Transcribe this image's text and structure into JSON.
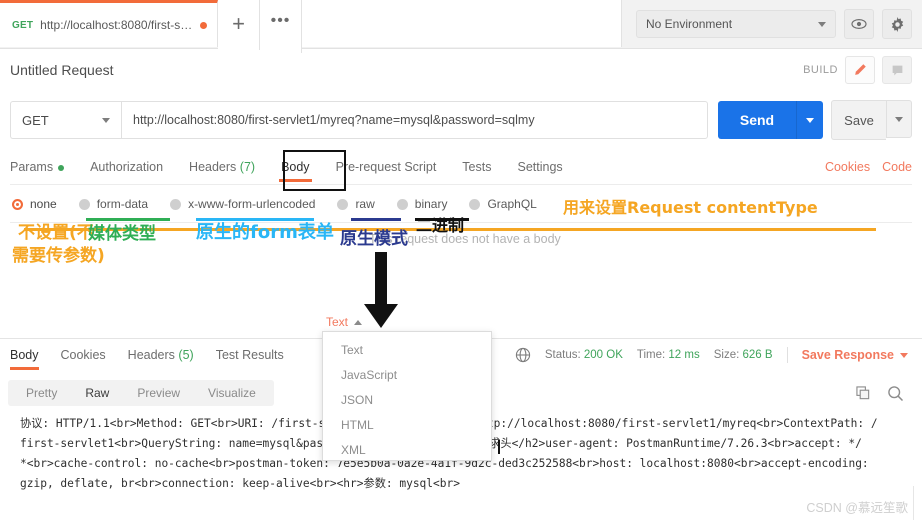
{
  "tabstrip": {
    "request_tab": {
      "method": "GET",
      "url": "http://localhost:8080/first-servl...",
      "unsaved": true
    },
    "new_tab_label": "+",
    "more_label": "•••",
    "environment": {
      "selected": "No Environment"
    },
    "eye_icon": "eye-icon",
    "gear_icon": "gear-icon"
  },
  "request_header": {
    "title": "Untitled Request",
    "build_label": "BUILD",
    "edit_icon": "pencil-icon",
    "comment_icon": "comment-icon"
  },
  "urlbar": {
    "method": "GET",
    "url": "http://localhost:8080/first-servlet1/myreq?name=mysql&password=sqlmy",
    "send_label": "Send",
    "save_label": "Save"
  },
  "request_tabs": {
    "items": [
      {
        "label": "Params",
        "badge": "",
        "dot": true,
        "active": false
      },
      {
        "label": "Authorization",
        "badge": "",
        "dot": false,
        "active": false
      },
      {
        "label": "Headers",
        "badge": "(7)",
        "dot": false,
        "active": false
      },
      {
        "label": "Body",
        "badge": "",
        "dot": false,
        "active": true
      },
      {
        "label": "Pre-request Script",
        "badge": "",
        "dot": false,
        "active": false
      },
      {
        "label": "Tests",
        "badge": "",
        "dot": false,
        "active": false
      },
      {
        "label": "Settings",
        "badge": "",
        "dot": false,
        "active": false
      }
    ],
    "right_links": [
      "Cookies",
      "Code"
    ]
  },
  "body_types": {
    "options": [
      {
        "label": "none",
        "selected": true
      },
      {
        "label": "form-data",
        "selected": false
      },
      {
        "label": "x-www-form-urlencoded",
        "selected": false
      },
      {
        "label": "raw",
        "selected": false
      },
      {
        "label": "binary",
        "selected": false
      },
      {
        "label": "GraphQL",
        "selected": false
      }
    ],
    "empty_message": "This request does not have a body"
  },
  "text_type": {
    "selected": "Text",
    "options": [
      "Text",
      "JavaScript",
      "JSON",
      "HTML",
      "XML"
    ]
  },
  "response": {
    "tabs": [
      {
        "label": "Body",
        "badge": "",
        "active": true
      },
      {
        "label": "Cookies",
        "badge": "",
        "active": false
      },
      {
        "label": "Headers",
        "badge": "(5)",
        "active": false
      },
      {
        "label": "Test Results",
        "badge": "",
        "active": false
      }
    ],
    "globe_icon": "globe-icon",
    "status_label": "Status:",
    "status_value": "200 OK",
    "time_label": "Time:",
    "time_value": "12 ms",
    "size_label": "Size:",
    "size_value": "626 B",
    "save_response_label": "Save Response",
    "view_tabs": [
      {
        "label": "Pretty",
        "active": false
      },
      {
        "label": "Raw",
        "active": true
      },
      {
        "label": "Preview",
        "active": false
      },
      {
        "label": "Visualize",
        "active": false
      }
    ],
    "copy_icon": "copy-icon",
    "search_icon": "search-icon",
    "body_lines": [
      "协议: HTTP/1.1<br>Method: GET<br>URI: /first-servlet1/myreq<br>URL: http://localhost:8080/first-servlet1/myreq<br>ContextPath: /",
      "first-servlet1<br>QueryString: name=mysql&password=sqlmy<br><hr><h2>请求头</h2>user-agent: PostmanRuntime/7.26.3<br>accept: */",
      "*<br>cache-control: no-cache<br>postman-token: 7e5e5b0a-0a2e-4a1f-9d2c-ded3c252588<br>host: localhost:8080<br>accept-encoding:",
      "gzip, deflate, br<br>connection: keep-alive<br><hr>参数: mysql<br>"
    ]
  },
  "annotations": {
    "content_type_note": "用来设置Request contentType",
    "none_note_line1": "不设置(不",
    "none_note_line2": "需要传参数)",
    "formdata_note": "媒体类型",
    "urlencoded_note": "原生的form表单",
    "raw_note": "原生模式",
    "binary_note": "二进制",
    "colors": {
      "orange": "#f5a623",
      "green": "#2fae55",
      "cyan": "#29b6f6",
      "navy": "#2b3a8f",
      "black": "#111111"
    }
  },
  "watermark": {
    "text": "CSDN @慕远笙歌"
  }
}
